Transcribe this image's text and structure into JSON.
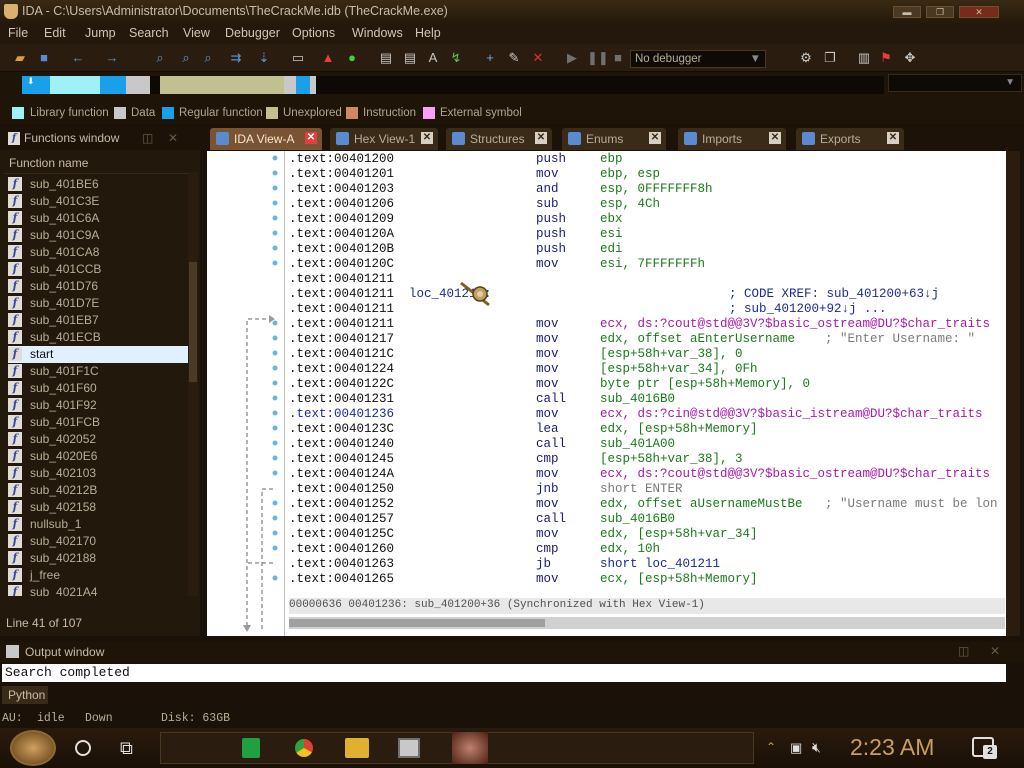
{
  "window": {
    "title": "IDA - C:\\Users\\Administrator\\Documents\\TheCrackMe.idb (TheCrackMe.exe)",
    "minimize_label": "▬",
    "maximize_label": "❐",
    "close_label": "✕"
  },
  "menu": [
    "File",
    "Edit",
    "Jump",
    "Search",
    "View",
    "Debugger",
    "Options",
    "Windows",
    "Help"
  ],
  "toolbar": {
    "debugger_select": "No debugger",
    "icons": [
      "open-icon",
      "save-icon",
      "back-arrow-icon",
      "forward-arrow-icon",
      "search-icon",
      "text-search-icon",
      "binary-search-icon",
      "jump-icon",
      "next-icon",
      "warning-icon",
      "green-circle-icon",
      "code-icon",
      "data-icon",
      "ascii-icon",
      "undefine-icon",
      "add-icon",
      "edit-icon",
      "delete-icon",
      "play-icon",
      "pause-icon",
      "stop-icon",
      "settings-icon",
      "graph-icon"
    ]
  },
  "legend": [
    {
      "label": "Library function",
      "color": "#a0f0f8"
    },
    {
      "label": "Data",
      "color": "#c8c8c8"
    },
    {
      "label": "Regular function",
      "color": "#1aa0e8"
    },
    {
      "label": "Unexplored",
      "color": "#c0c090"
    },
    {
      "label": "Instruction",
      "color": "#d08860"
    },
    {
      "label": "External symbol",
      "color": "#f8a0f8"
    }
  ],
  "functions_window": {
    "title": "Functions window",
    "column_header": "Function name",
    "items": [
      "sub_401BE6",
      "sub_401C3E",
      "sub_401C6A",
      "sub_401C9A",
      "sub_401CA8",
      "sub_401CCB",
      "sub_401D76",
      "sub_401D7E",
      "sub_401EB7",
      "sub_401ECB",
      "start",
      "sub_401F1C",
      "sub_401F60",
      "sub_401F92",
      "sub_401FCB",
      "sub_402052",
      "sub_4020E6",
      "sub_402103",
      "sub_40212B",
      "sub_402158",
      "nullsub_1",
      "sub_402170",
      "sub_402188",
      "j_free",
      "sub_4021A4"
    ],
    "selected": "start",
    "line_count": "Line 41 of 107"
  },
  "tabs": [
    {
      "label": "IDA View-A",
      "active": true
    },
    {
      "label": "Hex View-1",
      "active": false
    },
    {
      "label": "Structures",
      "active": false
    },
    {
      "label": "Enums",
      "active": false
    },
    {
      "label": "Imports",
      "active": false
    },
    {
      "label": "Exports",
      "active": false
    }
  ],
  "disassembly": [
    {
      "addr": ".text:00401200",
      "label": "",
      "mnem": "push",
      "ops": "ebp",
      "comment": ""
    },
    {
      "addr": ".text:00401201",
      "label": "",
      "mnem": "mov",
      "ops": "ebp, esp",
      "comment": ""
    },
    {
      "addr": ".text:00401203",
      "label": "",
      "mnem": "and",
      "ops": "esp, 0FFFFFFF8h",
      "comment": ""
    },
    {
      "addr": ".text:00401206",
      "label": "",
      "mnem": "sub",
      "ops": "esp, 4Ch",
      "comment": ""
    },
    {
      "addr": ".text:00401209",
      "label": "",
      "mnem": "push",
      "ops": "ebx",
      "comment": ""
    },
    {
      "addr": ".text:0040120A",
      "label": "",
      "mnem": "push",
      "ops": "esi",
      "comment": ""
    },
    {
      "addr": ".text:0040120B",
      "label": "",
      "mnem": "push",
      "ops": "edi",
      "comment": ""
    },
    {
      "addr": ".text:0040120C",
      "label": "",
      "mnem": "mov",
      "ops": "esi, 7FFFFFFFh",
      "comment": ""
    },
    {
      "addr": ".text:00401211",
      "label": "",
      "mnem": "",
      "ops": "",
      "comment": ""
    },
    {
      "addr": ".text:00401211",
      "label": "loc_401211:",
      "mnem": "",
      "ops": "",
      "comment": "; CODE XREF: sub_401200+63↓j"
    },
    {
      "addr": ".text:00401211",
      "label": "",
      "mnem": "",
      "ops": "",
      "comment": "; sub_401200+92↓j ..."
    },
    {
      "addr": ".text:00401211",
      "label": "",
      "mnem": "mov",
      "ops": "ecx, ds:?cout@std@@3V?$basic_ostream@DU?$char_traits",
      "comment": ""
    },
    {
      "addr": ".text:00401217",
      "label": "",
      "mnem": "mov",
      "ops": "edx, offset aEnterUsername",
      "comment": "; \"Enter Username: \""
    },
    {
      "addr": ".text:0040121C",
      "label": "",
      "mnem": "mov",
      "ops": "[esp+58h+var_38], 0",
      "comment": ""
    },
    {
      "addr": ".text:00401224",
      "label": "",
      "mnem": "mov",
      "ops": "[esp+58h+var_34], 0Fh",
      "comment": ""
    },
    {
      "addr": ".text:0040122C",
      "label": "",
      "mnem": "mov",
      "ops": "byte ptr [esp+58h+Memory], 0",
      "comment": ""
    },
    {
      "addr": ".text:00401231",
      "label": "",
      "mnem": "call",
      "ops": "sub_4016B0",
      "comment": ""
    },
    {
      "addr": ".text:00401236",
      "label": "",
      "mnem": "mov",
      "ops": "ecx, ds:?cin@std@@3V?$basic_istream@DU?$char_traits",
      "comment": ""
    },
    {
      "addr": ".text:0040123C",
      "label": "",
      "mnem": "lea",
      "ops": "edx, [esp+58h+Memory]",
      "comment": ""
    },
    {
      "addr": ".text:00401240",
      "label": "",
      "mnem": "call",
      "ops": "sub_401A00",
      "comment": ""
    },
    {
      "addr": ".text:00401245",
      "label": "",
      "mnem": "cmp",
      "ops": "[esp+58h+var_38], 3",
      "comment": ""
    },
    {
      "addr": ".text:0040124A",
      "label": "",
      "mnem": "mov",
      "ops": "ecx, ds:?cout@std@@3V?$basic_ostream@DU?$char_traits",
      "comment": ""
    },
    {
      "addr": ".text:00401250",
      "label": "",
      "mnem": "jnb",
      "ops": "short ENTER",
      "comment": ""
    },
    {
      "addr": ".text:00401252",
      "label": "",
      "mnem": "mov",
      "ops": "edx, offset aUsernameMustBe",
      "comment": "; \"Username must be lon"
    },
    {
      "addr": ".text:00401257",
      "label": "",
      "mnem": "call",
      "ops": "sub_4016B0",
      "comment": ""
    },
    {
      "addr": ".text:0040125C",
      "label": "",
      "mnem": "mov",
      "ops": "edx, [esp+58h+var_34]",
      "comment": ""
    },
    {
      "addr": ".text:00401260",
      "label": "",
      "mnem": "cmp",
      "ops": "edx, 10h",
      "comment": ""
    },
    {
      "addr": ".text:00401263",
      "label": "",
      "mnem": "jb",
      "ops": "short loc_401211",
      "comment": ""
    },
    {
      "addr": ".text:00401265",
      "label": "",
      "mnem": "mov",
      "ops": "ecx, [esp+58h+Memory]",
      "comment": ""
    }
  ],
  "view_status": "00000636 00401236: sub_401200+36 (Synchronized with Hex View-1)",
  "output_window": {
    "title": "Output window",
    "text": "Search completed",
    "python_tab": "Python"
  },
  "statusbar": {
    "au_label": "AU:",
    "au_state": "idle",
    "direction": "Down",
    "disk": "Disk: 63GB"
  },
  "taskbar": {
    "clock": "2:23 AM",
    "notification_count": "2"
  }
}
